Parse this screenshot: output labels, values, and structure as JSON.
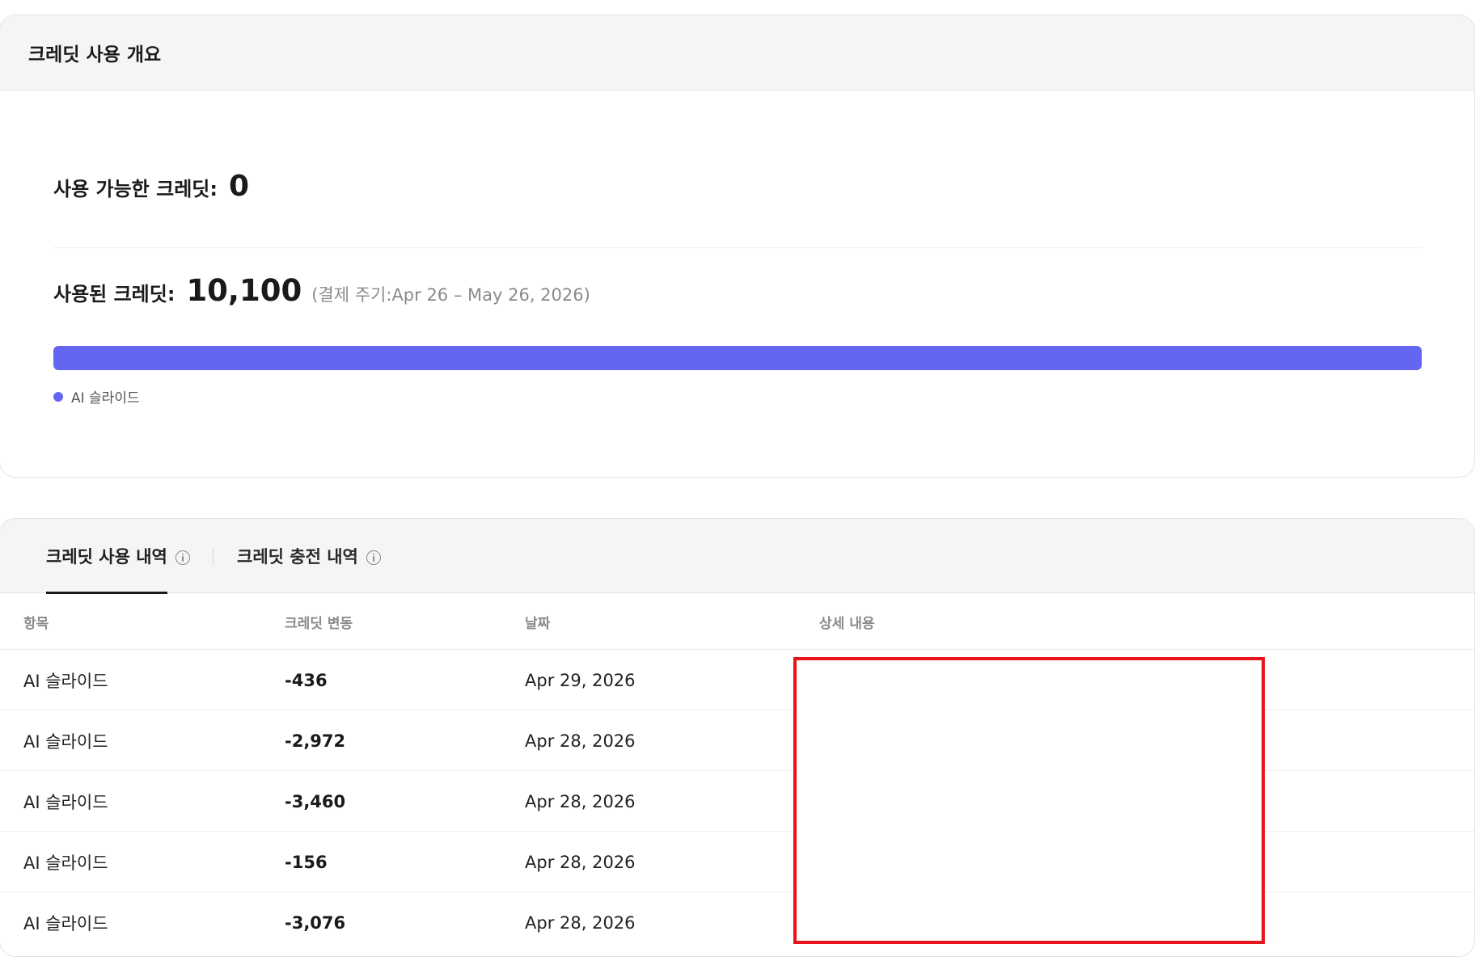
{
  "overview": {
    "title": "크레딧 사용 개요",
    "available_label": "사용 가능한 크레딧:",
    "available_value": "0",
    "used_label": "사용된 크레딧:",
    "used_value": "10,100",
    "billing_cycle": "(결제 주기:Apr 26 – May 26, 2026)",
    "usage_bar": {
      "fill_fraction": 1.0,
      "color": "#6466f1"
    },
    "legend": [
      {
        "label": "AI 슬라이드",
        "color": "#6466f1"
      }
    ]
  },
  "history": {
    "tabs": [
      {
        "label": "크레딧 사용 내역",
        "icon": "info-icon",
        "active": true
      },
      {
        "label": "크레딧 충전 내역",
        "icon": "info-icon",
        "active": false
      }
    ],
    "columns": [
      "항목",
      "크레딧 변동",
      "날짜",
      "상세 내용"
    ],
    "rows": [
      {
        "item": "AI 슬라이드",
        "change": "-436",
        "date": "Apr 29, 2026",
        "detail": ""
      },
      {
        "item": "AI 슬라이드",
        "change": "-2,972",
        "date": "Apr 28, 2026",
        "detail": ""
      },
      {
        "item": "AI 슬라이드",
        "change": "-3,460",
        "date": "Apr 28, 2026",
        "detail": ""
      },
      {
        "item": "AI 슬라이드",
        "change": "-156",
        "date": "Apr 28, 2026",
        "detail": ""
      },
      {
        "item": "AI 슬라이드",
        "change": "-3,076",
        "date": "Apr 28, 2026",
        "detail": ""
      }
    ]
  },
  "colors": {
    "accent": "#6466f1",
    "redaction_border": "#e8141b"
  }
}
